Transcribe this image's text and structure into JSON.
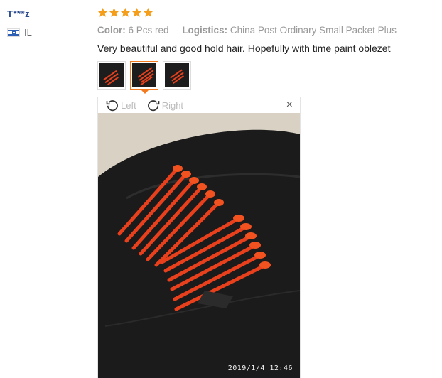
{
  "reviewer": {
    "name": "T***z",
    "country": "IL",
    "flag_icon": "israel-flag-icon"
  },
  "rating": {
    "stars": 5,
    "max": 5,
    "color": "#f49e1b"
  },
  "meta": {
    "color_label": "Color:",
    "color_value": "6 Pcs red",
    "logistics_label": "Logistics:",
    "logistics_value": "China Post Ordinary Small Packet Plus"
  },
  "review_text": "Very beautiful and good hold hair. Hopefully with time paint oblezet",
  "thumbnails": [
    {
      "name": "review-photo-1",
      "selected": false
    },
    {
      "name": "review-photo-2",
      "selected": true
    },
    {
      "name": "review-photo-3",
      "selected": false
    }
  ],
  "viewer": {
    "rotate_left_label": "Left",
    "rotate_right_label": "Right",
    "close_symbol": "×",
    "photo_timestamp": "2019/1/4  12:46"
  },
  "colors": {
    "accent": "#f47a20",
    "name_link": "#2a4b8d"
  }
}
